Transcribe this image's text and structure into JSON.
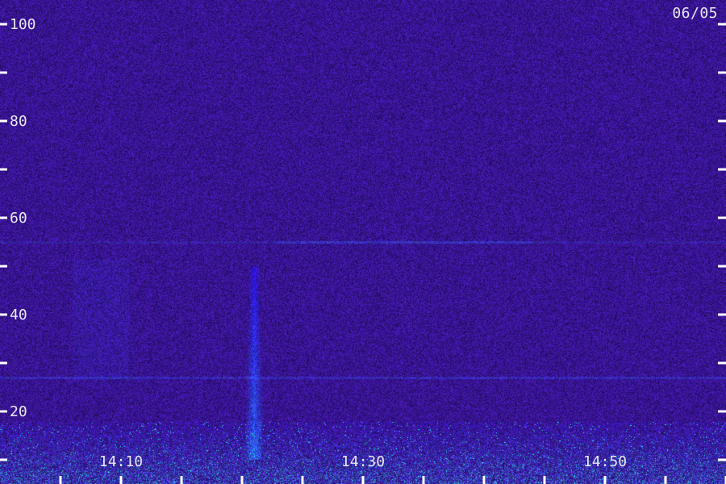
{
  "date_label": "06/05",
  "colors": {
    "background": "#2a1270",
    "noise_low": "#1c0d5e",
    "noise_high": "#4a2cb4",
    "signal": "#2f6bff",
    "hot": "#27e0e8",
    "tick": "#ffffff",
    "label": "#e8e8f0"
  },
  "chart_data": {
    "type": "heatmap",
    "title": "",
    "xlabel": "",
    "ylabel": "",
    "y_ticks_labeled": [
      20,
      40,
      60,
      80,
      100
    ],
    "y_ticks_all": [
      10,
      20,
      30,
      40,
      50,
      60,
      70,
      80,
      90,
      100
    ],
    "y_range": [
      5,
      103
    ],
    "x_tick_labels": [
      "14:10",
      "14:30",
      "14:50"
    ],
    "x_range_minutes": [
      "14:03",
      "15:02"
    ],
    "x_ticks_minor_every_minutes": 5,
    "features": [
      {
        "kind": "vertical-burst",
        "time": "14:21",
        "freq_top": 50,
        "freq_bottom": 8
      },
      {
        "kind": "horizontal-band",
        "freq": 55
      },
      {
        "kind": "horizontal-band",
        "freq": 27
      },
      {
        "kind": "dense-noise-floor",
        "freq_top": 18
      }
    ]
  }
}
